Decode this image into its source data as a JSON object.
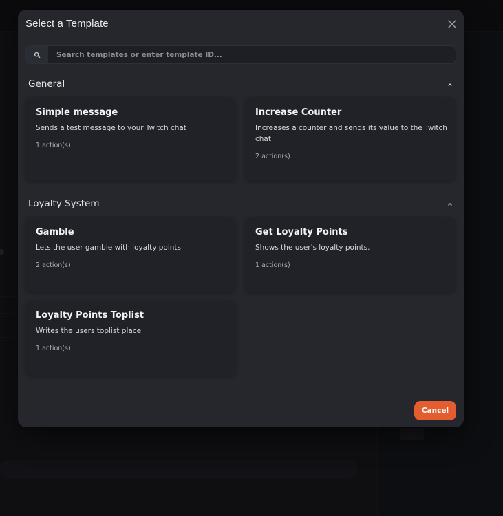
{
  "modal": {
    "title": "Select a Template",
    "close_icon": "close-icon"
  },
  "search": {
    "placeholder": "Search templates or enter template ID...",
    "value": "",
    "icon": "search-icon"
  },
  "sections": [
    {
      "title": "General",
      "chevron_icon": "chevron-up-icon",
      "expanded": true,
      "templates": [
        {
          "title": "Simple message",
          "description": "Sends a test message to your Twitch chat",
          "actions": "1 action(s)"
        },
        {
          "title": "Increase Counter",
          "description": "Increases a counter and sends its value to the Twitch chat",
          "actions": "2 action(s)"
        }
      ]
    },
    {
      "title": "Loyalty System",
      "chevron_icon": "chevron-up-icon",
      "expanded": true,
      "templates": [
        {
          "title": "Gamble",
          "description": "Lets the user gamble with loyalty points",
          "actions": "2 action(s)"
        },
        {
          "title": "Get Loyalty Points",
          "description": "Shows the user's loyalty points.",
          "actions": "1 action(s)"
        },
        {
          "title": "Loyalty Points Toplist",
          "description": "Writes the users toplist place",
          "actions": "1 action(s)"
        }
      ]
    }
  ],
  "footer": {
    "cancel_label": "Cancel"
  },
  "colors": {
    "modal_bg": "#25272d",
    "card_bg": "#202227",
    "accent": "#e25d30",
    "text_primary": "#f2f2f4",
    "text_secondary": "#a9abb1"
  }
}
